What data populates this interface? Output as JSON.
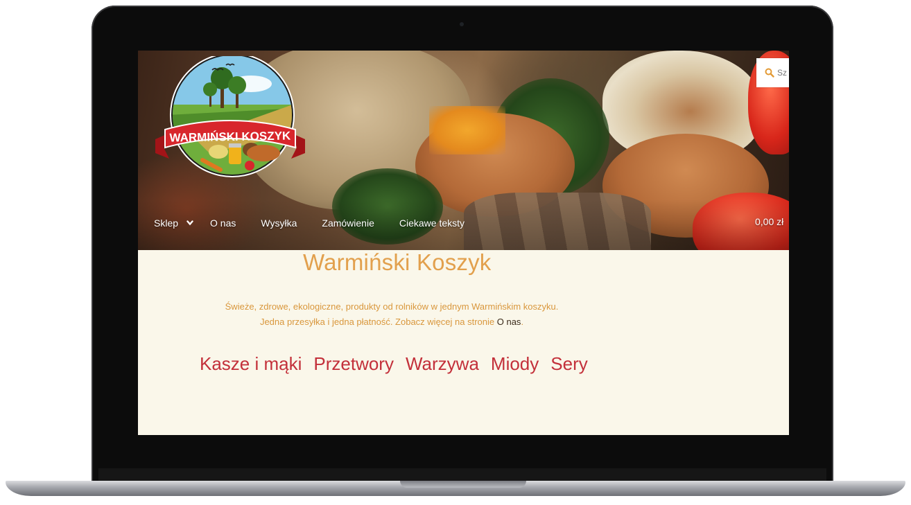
{
  "logo": {
    "text": "WARMIŃSKI KOSZYK",
    "colors": {
      "ribbon": "#d8262c",
      "sky": "#7ec4e6",
      "field": "#6faa3a"
    }
  },
  "search": {
    "placeholder": "Sz"
  },
  "nav": {
    "items": [
      {
        "label": "Sklep",
        "has_dropdown": true
      },
      {
        "label": "O nas"
      },
      {
        "label": "Wysyłka"
      },
      {
        "label": "Zamówienie"
      },
      {
        "label": "Ciekawe teksty"
      }
    ],
    "cart_total": "0,00 zł"
  },
  "site": {
    "title": "Warmiński Koszyk",
    "tagline_line1": "Świeże, zdrowe, ekologiczne, produkty od rolników w jednym Warmińskim koszyku.",
    "tagline_line2_prefix": "Jedna przesyłka i jedna płatność. Zobacz więcej na stronie",
    "tagline_link": "O nas",
    "tagline_suffix": "."
  },
  "categories": [
    "Kasze i mąki",
    "Przetwory",
    "Warzywa",
    "Miody",
    "Sery"
  ],
  "colors": {
    "background": "#faf7ea",
    "title": "#e2a04d",
    "tagline": "#d9973c",
    "category_link": "#c3303a"
  },
  "icons": {
    "search": "search-icon",
    "dropdown": "chevron-down-icon"
  }
}
